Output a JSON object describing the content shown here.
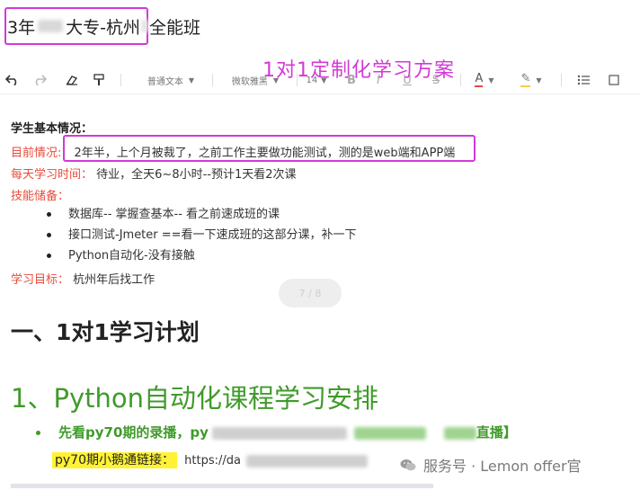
{
  "title": {
    "part1": "3年",
    "part2": "大专-杭州",
    "part3": "全能班"
  },
  "overlay_label": "1对1定制化学习方案",
  "toolbar": {
    "style_select": "普通文本",
    "font_select": "微软雅黑",
    "size_select": "14",
    "bold": "B",
    "italic": "I",
    "underline": "U",
    "strike": "S",
    "font_color": "A"
  },
  "student": {
    "heading": "学生基本情况：",
    "current_label": "目前情况:",
    "current_value": "2年半，上个月被裁了，之前工作主要做功能测试，测的是web端和APP端",
    "daily_label": "每天学习时间：",
    "daily_value": "待业，全天6~8小时--预计1天看2次课",
    "skills_label": "技能储备：",
    "skills": [
      "数据库-- 掌握查基本-- 看之前速成班的课",
      "接口测试-Jmeter ==看一下速成班的这部分课，补一下",
      "Python自动化-没有接触"
    ],
    "goal_label": "学习目标：",
    "goal_value": "杭州年后找工作"
  },
  "page_indicator": "7 / 8",
  "section1": "一、1对1学习计划",
  "section2": "1、Python自动化课程学习安排",
  "bullet_green": {
    "prefix": "先看py70期的录播，py",
    "suffix": "直播】"
  },
  "link": {
    "label": "py70期小鹅通链接：",
    "url_prefix": "https://da"
  },
  "watermark": "服务号 · Lemon offer官"
}
